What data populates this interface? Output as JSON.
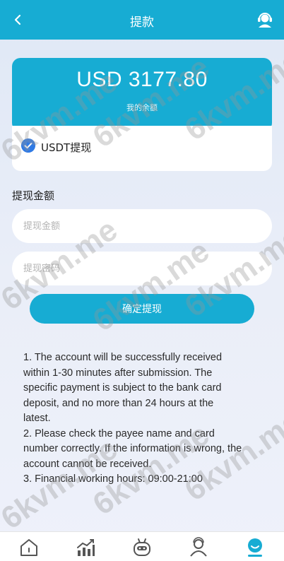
{
  "header": {
    "title": "提款",
    "back_icon": "chevron-left-icon",
    "support_icon": "customer-service-icon"
  },
  "balance": {
    "amount": "USD 3177.80",
    "label": "我的余额"
  },
  "method": {
    "label": "USDT提现",
    "selected": true
  },
  "form": {
    "section_label": "提现金额",
    "amount_placeholder": "提现金额",
    "password_placeholder": "提现密码",
    "submit_label": "确定提现"
  },
  "notes": [
    "1. The account will be successfully received within 1-30 minutes after submission. The specific payment is subject to the bank card deposit, and no more than 24 hours at the latest.",
    "2. Please check the payee name and card number correctly. If the information is wrong, the account cannot be received.",
    "3. Financial working hours: 09:00-21:00"
  ],
  "watermark": "6kvm.me",
  "tabbar": {
    "items": [
      "home-icon",
      "chart-icon",
      "robot-icon",
      "team-icon",
      "profile-icon"
    ],
    "active_index": 4
  },
  "colors": {
    "primary": "#17acd3",
    "check": "#2f7ae5"
  }
}
